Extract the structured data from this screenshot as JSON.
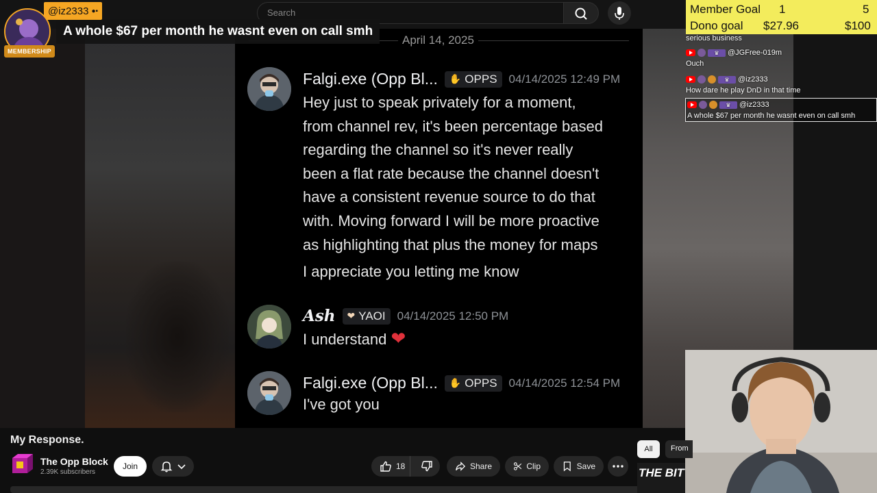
{
  "search": {
    "placeholder": "Search"
  },
  "alert": {
    "username": "@iz2333",
    "message": "A whole $67 per month he wasnt even on call smh",
    "badge": "MEMBERSHIP"
  },
  "discord": {
    "date": "April 14, 2025",
    "messages": [
      {
        "author": "Falgi.exe (Opp Bl...",
        "role": "OPPS",
        "time": "04/14/2025 12:49 PM",
        "lines": [
          "Hey just to speak privately for a moment,",
          "from channel rev, it's been percentage based",
          "regarding the channel so it's never really",
          "been a flat rate because the channel doesn't",
          "have a consistent revenue source to do that",
          "with. Moving forward I will be more proactive",
          "as highlighting that plus the money for maps"
        ],
        "followup": "I appreciate you letting me know"
      },
      {
        "author": "Ash",
        "role": "YAOI",
        "time": "04/14/2025 12:50 PM",
        "text": "I understand"
      },
      {
        "author": "Falgi.exe (Opp Bl...",
        "role": "OPPS",
        "time": "04/14/2025 12:54 PM",
        "text": "I've got you"
      }
    ]
  },
  "goals": {
    "member": {
      "label": "Member Goal",
      "current": "1",
      "target": "5"
    },
    "dono": {
      "label": "Dono goal",
      "current": "$27.96",
      "target": "$100"
    }
  },
  "chat": {
    "items": [
      {
        "text": "serious business"
      },
      {
        "user": "@JGFree-019m",
        "text": "Ouch"
      },
      {
        "user": "@iz2333",
        "text": "How dare he play DnD in that time"
      },
      {
        "user": "@iz2333",
        "text": "A whole $67 per month he wasnt even on call smh"
      }
    ]
  },
  "video": {
    "title": "My Response.",
    "channel": "The Opp Block",
    "subscribers": "2.39K subscribers",
    "join": "Join",
    "likes": "18",
    "share": "Share",
    "clip": "Clip",
    "save": "Save"
  },
  "chips": {
    "all": "All",
    "from": "From"
  },
  "thumbnail": {
    "text": "THE BITTER"
  },
  "colors": {
    "goal_bg": "#f3ec5c",
    "alert": "#f5a623",
    "heart": "#e0313b"
  }
}
